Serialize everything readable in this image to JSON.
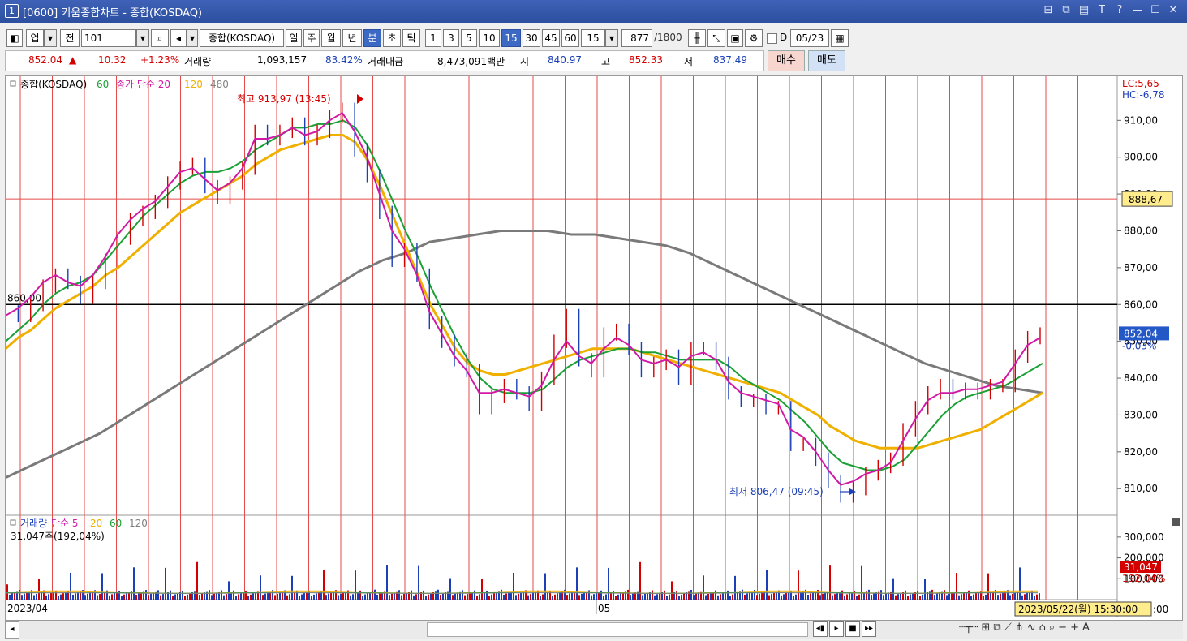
{
  "window": {
    "number": "1",
    "title": "[0600] 키움종합차트 - 종합(KOSDAQ)",
    "icons": [
      "⊟",
      "⧉",
      "▤",
      "T",
      "?",
      "—",
      "☐",
      "✕"
    ]
  },
  "toolbar": {
    "market": "업",
    "view": "전",
    "code": "101",
    "name": "종합(KOSDAQ)",
    "periods": [
      "일",
      "주",
      "월",
      "년",
      "분",
      "초",
      "틱"
    ],
    "selected_period": "분",
    "minutes": [
      "1",
      "3",
      "5",
      "10",
      "15",
      "30",
      "45",
      "60"
    ],
    "selected_minute": "15",
    "interval_value": "15",
    "count": "877",
    "count_max": "/1800",
    "d_label": "D",
    "date": "05/23"
  },
  "quote": {
    "price": "852.04",
    "change": "10.32",
    "change_pct": "+1.23%",
    "volume_label": "거래량",
    "volume": "1,093,157",
    "volume_pct": "83.42%",
    "amount_label": "거래대금",
    "amount": "8,473,091백만",
    "open_label": "시",
    "open": "840.97",
    "high_label": "고",
    "high": "852.33",
    "low_label": "저",
    "low": "837.49",
    "buy": "매수",
    "sell": "매도"
  },
  "chart_data": {
    "type": "line",
    "title": "종합(KOSDAQ)",
    "legend": [
      {
        "label": "종합(KOSDAQ)",
        "color": "#000000"
      },
      {
        "label": "60",
        "color": "#1aa034"
      },
      {
        "label": "종가 단순 20",
        "color": "#d01aa6"
      },
      {
        "label": "120",
        "color": "#f0b000"
      },
      {
        "label": "480",
        "color": "#808080"
      }
    ],
    "x_labels": [
      "2023/04",
      "05"
    ],
    "ylim": [
      803,
      918
    ],
    "y_ticks": [
      "910,00",
      "900,00",
      "890,00",
      "880,00",
      "870,00",
      "860,00",
      "850,00",
      "840,00",
      "830,00",
      "820,00",
      "810,00"
    ],
    "lc": "LC:5,65",
    "hc": "HC:-6,78",
    "cursor_value": "888,67",
    "current_value": "852,04",
    "current_pct": "-0,03%",
    "hline_label": "860,00",
    "hline_value": 860,
    "hline2_value": 888.67,
    "high_annotation": "최고 913,97 (13:45)",
    "low_annotation": "최저 806,47 (09:45)",
    "price": [
      858,
      857,
      860,
      865,
      868,
      866,
      862,
      866,
      872,
      878,
      883,
      885,
      888,
      893,
      897,
      898,
      892,
      889,
      893,
      897,
      907,
      905,
      907,
      909,
      905,
      907,
      911,
      913,
      902,
      895,
      885,
      872,
      875,
      868,
      855,
      850,
      845,
      842,
      832,
      835,
      838,
      836,
      833,
      840,
      850,
      857,
      845,
      842,
      852,
      853,
      848,
      842,
      844,
      846,
      840,
      848,
      848,
      844,
      836,
      834,
      834,
      832,
      832,
      822,
      822,
      818,
      812,
      808,
      810,
      814,
      816,
      818,
      826,
      832,
      836,
      838,
      836,
      837,
      836,
      838,
      838,
      846,
      851,
      852
    ],
    "ma20": [
      857,
      859,
      862,
      866,
      868,
      866,
      865,
      868,
      873,
      879,
      883,
      886,
      888,
      892,
      896,
      897,
      894,
      891,
      893,
      897,
      905,
      905,
      906,
      908,
      906,
      907,
      910,
      912,
      907,
      900,
      890,
      880,
      875,
      868,
      858,
      852,
      846,
      842,
      836,
      836,
      837,
      836,
      835,
      838,
      845,
      850,
      846,
      844,
      848,
      851,
      849,
      845,
      844,
      845,
      843,
      846,
      847,
      845,
      839,
      836,
      835,
      834,
      833,
      826,
      824,
      820,
      815,
      811,
      812,
      814,
      815,
      817,
      823,
      829,
      834,
      836,
      836,
      837,
      837,
      838,
      839,
      844,
      849,
      851
    ],
    "ma60": [
      850,
      853,
      856,
      860,
      863,
      865,
      866,
      868,
      872,
      876,
      880,
      884,
      887,
      890,
      893,
      895,
      896,
      896,
      897,
      899,
      902,
      904,
      906,
      908,
      908,
      909,
      909,
      910,
      908,
      903,
      896,
      888,
      880,
      873,
      865,
      858,
      851,
      845,
      840,
      837,
      836,
      836,
      836,
      837,
      840,
      843,
      845,
      846,
      847,
      848,
      848,
      847,
      847,
      846,
      845,
      845,
      845,
      845,
      843,
      840,
      838,
      836,
      834,
      831,
      828,
      824,
      820,
      817,
      816,
      815,
      815,
      816,
      818,
      822,
      826,
      830,
      833,
      835,
      836,
      837,
      838,
      840,
      842,
      844
    ],
    "ma120": [
      848,
      851,
      853,
      856,
      859,
      861,
      863,
      865,
      868,
      870,
      873,
      876,
      879,
      882,
      885,
      887,
      889,
      891,
      893,
      895,
      898,
      900,
      902,
      903,
      904,
      905,
      906,
      906,
      904,
      899,
      892,
      884,
      876,
      868,
      860,
      854,
      848,
      844,
      842,
      841,
      841,
      842,
      843,
      844,
      845,
      846,
      847,
      848,
      848,
      848,
      848,
      847,
      846,
      845,
      844,
      843,
      842,
      841,
      840,
      839,
      838,
      837,
      836,
      834,
      832,
      830,
      827,
      825,
      823,
      822,
      821,
      821,
      821,
      821,
      822,
      823,
      824,
      825,
      826,
      828,
      830,
      832,
      834,
      836
    ],
    "ma480": [
      813,
      816,
      819,
      822,
      825,
      829,
      833,
      837,
      841,
      845,
      849,
      853,
      857,
      861,
      865,
      869,
      872,
      874,
      877,
      878,
      879,
      880,
      880,
      880,
      879,
      879,
      878,
      877,
      876,
      874,
      871,
      868,
      865,
      862,
      859,
      856,
      853,
      850,
      847,
      844,
      842,
      840,
      838,
      837,
      836
    ]
  },
  "volume_panel": {
    "legend": [
      {
        "label": "거래량",
        "color": "#1a3fb7"
      },
      {
        "label": "단순 5",
        "color": "#d01aa6"
      },
      {
        "label": "20",
        "color": "#f0b000"
      },
      {
        "label": "60",
        "color": "#1aa034"
      },
      {
        "label": "120",
        "color": "#808080"
      }
    ],
    "current_text": "31,047주(192,04%)",
    "y_ticks": [
      "300,000",
      "200,000",
      "100,000"
    ],
    "current_value": "31,047",
    "current_pct": "192,04%",
    "date_tooltip": "2023/05/22(월) 15:30:00",
    "tick_suffix": ":00",
    "ylim": [
      0,
      350000
    ]
  }
}
